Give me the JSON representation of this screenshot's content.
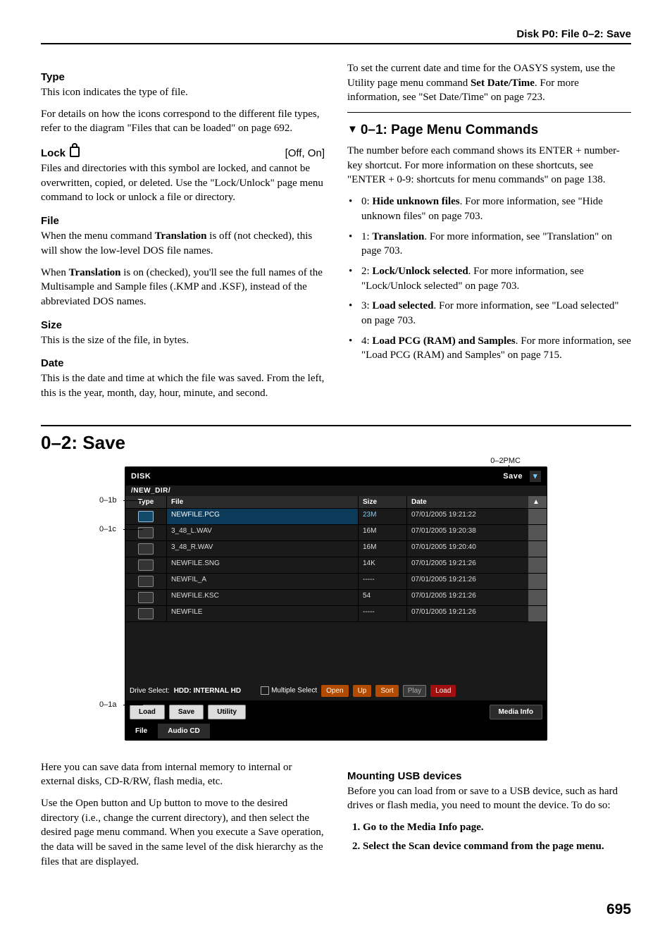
{
  "running_head": "Disk P0: File    0–2: Save",
  "left_col": {
    "type_h": "Type",
    "type_p": "This icon indicates the type of file.",
    "type_p2": "For details on how the icons correspond to the different file types, refer to the diagram \"Files that can be loaded\" on page 692.",
    "lock_h": "Lock",
    "lock_rhs": "[Off, On]",
    "lock_p": "Files and directories with this symbol are locked, and cannot be overwritten, copied, or deleted. Use the \"Lock/Unlock\" page menu command to lock or unlock a file or directory.",
    "file_h": "File",
    "file_p1a": "When the menu command ",
    "file_p1b": "Translation",
    "file_p1c": " is off (not checked), this will show the low-level DOS file names.",
    "file_p2a": "When ",
    "file_p2b": "Translation",
    "file_p2c": " is on (checked), you'll see the full names of the Multisample and Sample files (.KMP and .KSF), instead of the abbreviated DOS names.",
    "size_h": "Size",
    "size_p": "This is the size of the file, in bytes.",
    "date_h": "Date",
    "date_p": "This is the date and time at which the file was saved. From the left, this is the year, month, day, hour, minute, and second."
  },
  "right_col": {
    "intro_a": "To set the current date and time for the OASYS system, use the Utility page menu command ",
    "intro_b": "Set Date/Time",
    "intro_c": ". For more information, see \"Set Date/Time\" on page 723.",
    "menu_h": "0–1: Page Menu Commands",
    "menu_intro": "The number before each command shows its ENTER + number-key shortcut. For more information on these shortcuts, see \"ENTER + 0-9: shortcuts for menu commands\" on page 138.",
    "items": [
      {
        "t": "0: ",
        "b": "Hide unknown files",
        "r": ". For more information, see \"Hide unknown files\" on page 703."
      },
      {
        "t": "1: ",
        "b": "Translation",
        "r": ". For more information, see \"Translation\" on page 703."
      },
      {
        "t": "2: ",
        "b": "Lock/Unlock selected",
        "r": ". For more information, see \"Lock/Unlock selected\" on page 703."
      },
      {
        "t": "3: ",
        "b": "Load selected",
        "r": ". For more information, see \"Load selected\" on page 703."
      },
      {
        "t": "4: ",
        "b": "Load PCG (RAM) and Samples",
        "r": ". For more information, see \"Load PCG (RAM) and Samples\" on page 715."
      }
    ]
  },
  "save_h": "0–2: Save",
  "labels": {
    "pmc": "0–2PMC",
    "b": "0–1b",
    "c": "0–1c",
    "a": "0–1a"
  },
  "shot": {
    "title_left": "DISK",
    "title_right": "Save",
    "menu_icon": "▾",
    "path": "/NEW_DIR/",
    "hdr": {
      "type": "Type",
      "file": "File",
      "size": "Size",
      "date": "Date"
    },
    "rows": [
      {
        "file": "NEWFILE.PCG",
        "size": "23M",
        "date": "07/01/2005  19:21:22",
        "sel": true
      },
      {
        "file": "3_48_L.WAV",
        "size": "16M",
        "date": "07/01/2005  19:20:38"
      },
      {
        "file": "3_48_R.WAV",
        "size": "16M",
        "date": "07/01/2005  19:20:40"
      },
      {
        "file": "NEWFILE.SNG",
        "size": "14K",
        "date": "07/01/2005  19:21:26"
      },
      {
        "file": "NEWFIL_A",
        "size": "-----",
        "date": "07/01/2005  19:21:26"
      },
      {
        "file": "NEWFILE.KSC",
        "size": "54",
        "date": "07/01/2005  19:21:26"
      },
      {
        "file": "NEWFILE",
        "size": "-----",
        "date": "07/01/2005  19:21:26"
      }
    ],
    "drive_label": "Drive Select:",
    "drive_value": "HDD: INTERNAL HD",
    "multi": "Multiple Select",
    "btns": {
      "open": "Open",
      "up": "Up",
      "sort": "Sort",
      "play": "Play",
      "load": "Load"
    },
    "tabs1": {
      "load": "Load",
      "save": "Save",
      "utility": "Utility",
      "media": "Media Info"
    },
    "tabs2": {
      "file": "File",
      "audio": "Audio CD"
    }
  },
  "bottom_left": {
    "p1": "Here you can save data from internal memory to internal or external disks, CD-R/RW, flash media, etc.",
    "p2": "Use the Open button and Up button to move to the desired directory (i.e., change the current directory), and then select the desired page menu command. When you execute a Save operation, the data will be saved in the same level of the disk hierarchy as the files that are displayed."
  },
  "bottom_right": {
    "h": "Mounting USB devices",
    "p": "Before you can load from or save to a USB device, such as hard drives or flash media, you need to mount the device. To do so:",
    "steps": [
      "Go to the Media Info page.",
      "Select the Scan device command from the page menu."
    ]
  },
  "page_num": "695"
}
